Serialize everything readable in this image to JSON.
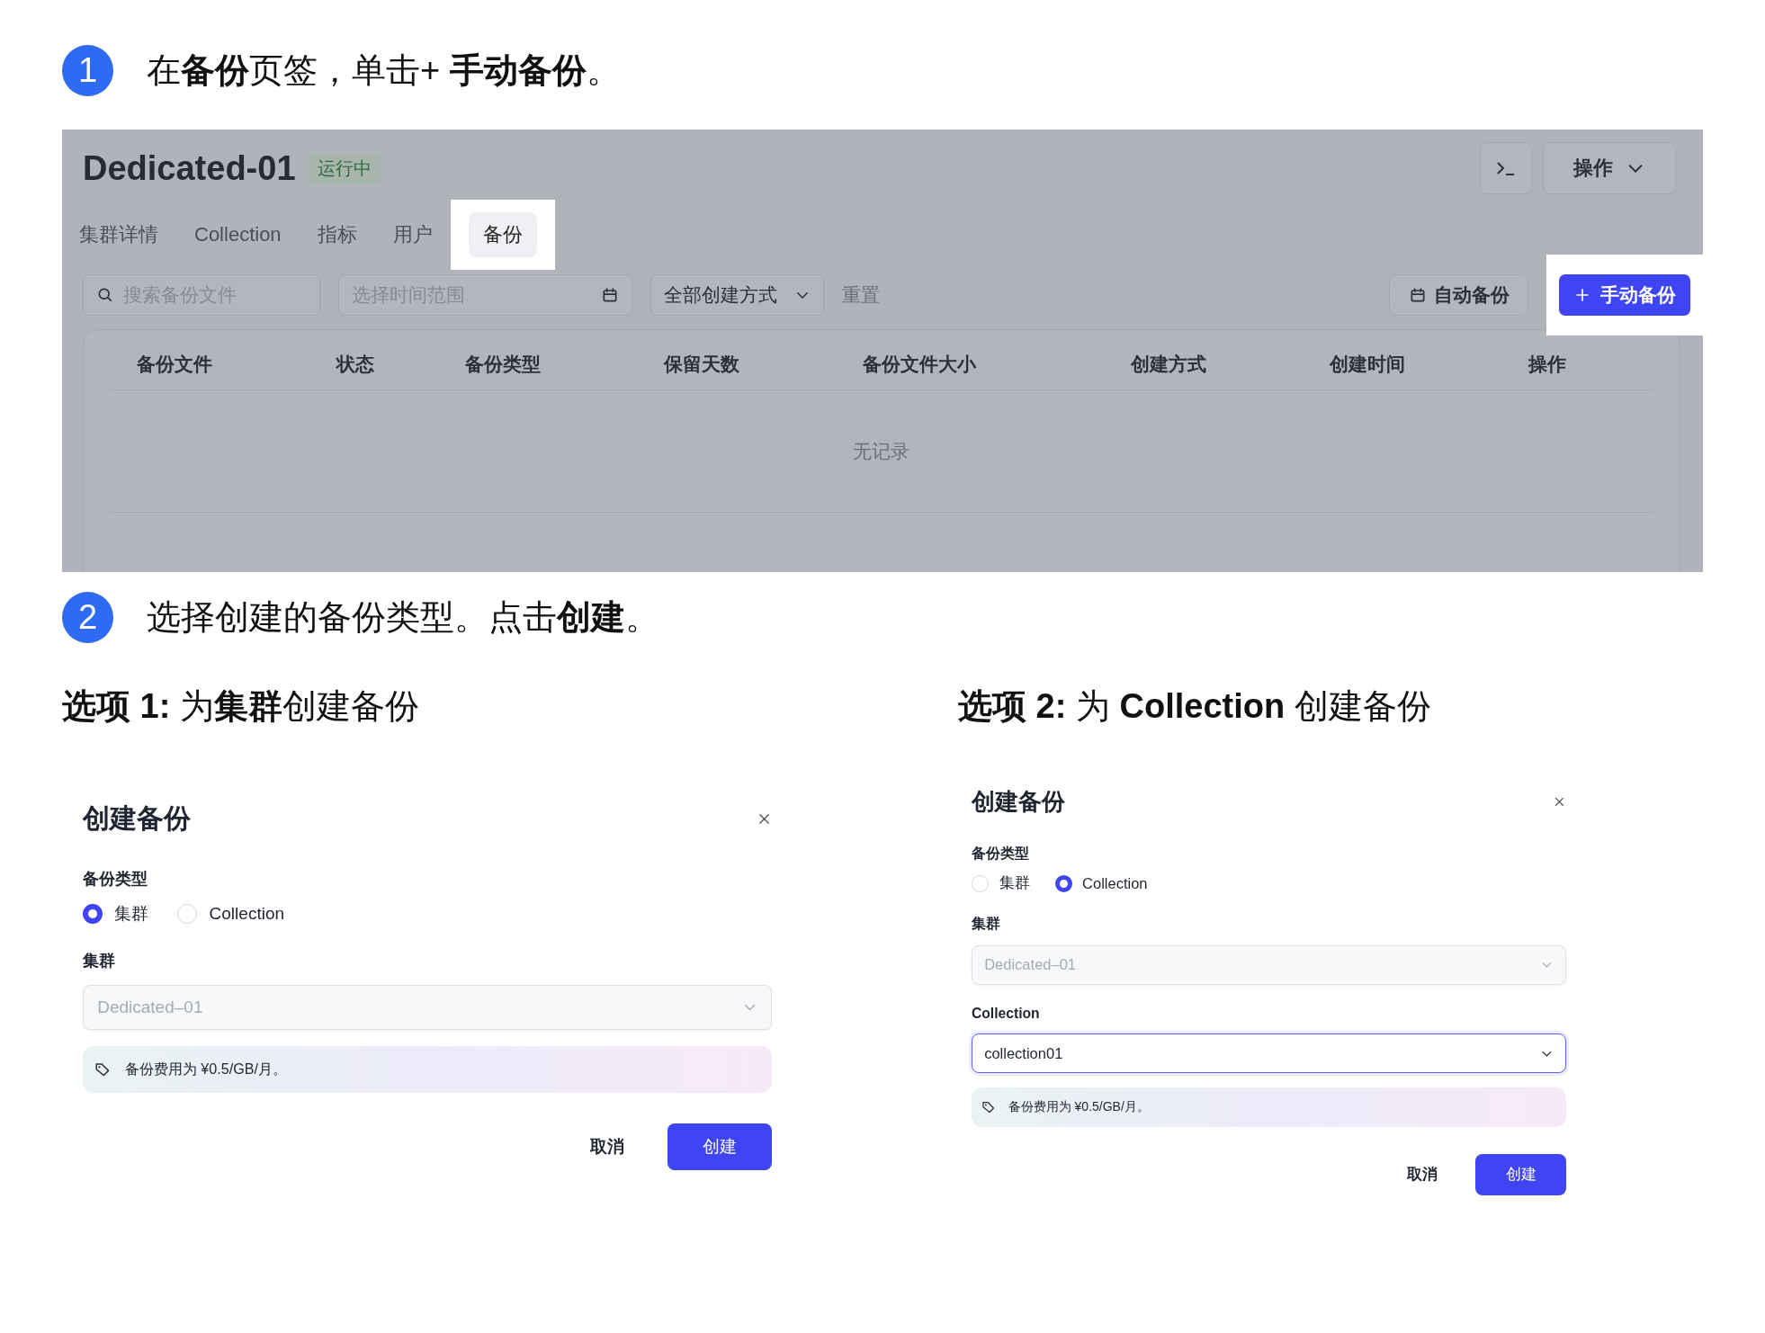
{
  "steps": [
    {
      "number": "1",
      "text": "在**备份**页签，单击+ **手动备份**。"
    },
    {
      "number": "2",
      "text": "选择创建的备份类型。点击**创建**。"
    }
  ],
  "screenshot": {
    "title": "Dedicated-01",
    "status_badge": "运行中",
    "actions_button": "操作",
    "tabs": [
      {
        "label": "集群详情",
        "selected": false,
        "highlighted": false
      },
      {
        "label": "Collection",
        "selected": false,
        "highlighted": false
      },
      {
        "label": "指标",
        "selected": false,
        "highlighted": false
      },
      {
        "label": "用户",
        "selected": false,
        "highlighted": false
      },
      {
        "label": "备份",
        "selected": true,
        "highlighted": true
      }
    ],
    "search": {
      "placeholder": "搜索备份文件"
    },
    "date_range": {
      "placeholder": "选择时间范围"
    },
    "method_select": "全部创建方式",
    "reset_link": "重置",
    "auto_backup_button": "自动备份",
    "manual_backup_button": {
      "label": "手动备份",
      "highlighted": true
    },
    "table": {
      "columns": [
        "备份文件",
        "状态",
        "备份类型",
        "保留天数",
        "备份文件大小",
        "创建方式",
        "创建时间",
        "操作"
      ],
      "empty_text": "无记录"
    }
  },
  "options": [
    {
      "heading": "**选项 1:** 为**集群**创建备份",
      "dialog": {
        "title": "创建备份",
        "type_label": "备份类型",
        "radios": [
          {
            "label": "集群",
            "selected": true
          },
          {
            "label": "Collection",
            "selected": false
          }
        ],
        "fields": [
          {
            "label": "集群",
            "value": "Dedicated–01",
            "disabled": true
          }
        ],
        "notice": "备份费用为 ¥0.5/GB/月。",
        "cancel": "取消",
        "confirm": "创建"
      }
    },
    {
      "heading": "**选项 2:** 为 **Collection** 创建备份",
      "dialog": {
        "title": "创建备份",
        "type_label": "备份类型",
        "radios": [
          {
            "label": "集群",
            "selected": false
          },
          {
            "label": "Collection",
            "selected": true
          }
        ],
        "fields": [
          {
            "label": "集群",
            "value": "Dedicated–01",
            "disabled": true
          },
          {
            "label": "Collection",
            "value": "collection01",
            "disabled": false
          }
        ],
        "notice": "备份费用为 ¥0.5/GB/月。",
        "cancel": "取消",
        "confirm": "创建"
      }
    }
  ]
}
